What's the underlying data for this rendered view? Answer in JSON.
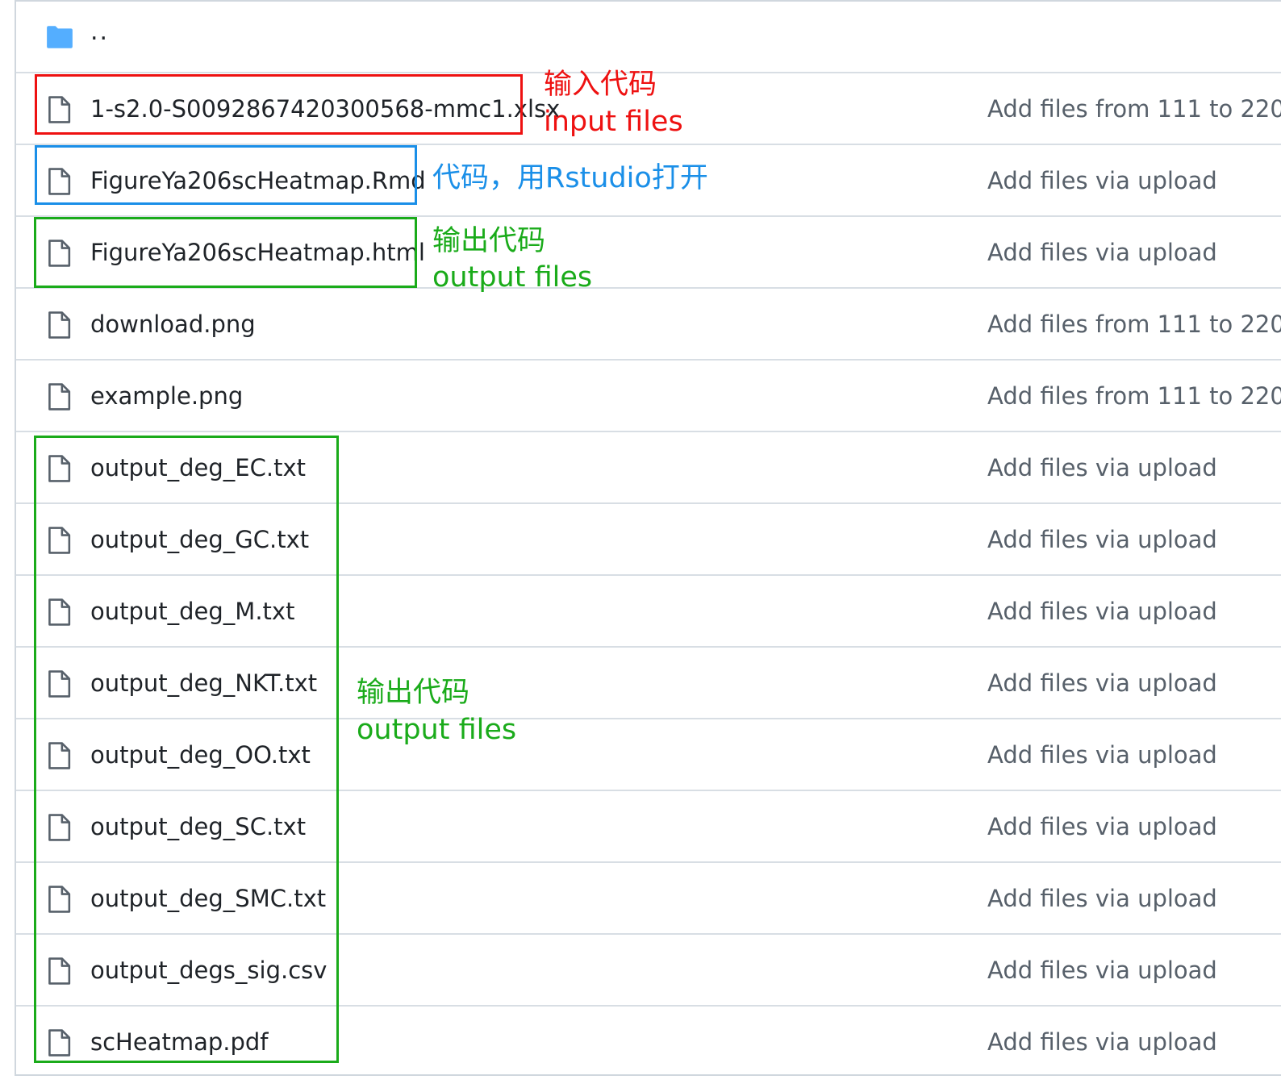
{
  "parent_dir": {
    "label": "..",
    "icon": "folder-icon"
  },
  "files": [
    {
      "name": "1-s2.0-S0092867420300568-mmc1.xlsx",
      "commit_message": "Add files from 111 to 220",
      "icon": "file-icon"
    },
    {
      "name": "FigureYa206scHeatmap.Rmd",
      "commit_message": "Add files via upload",
      "icon": "file-icon"
    },
    {
      "name": "FigureYa206scHeatmap.html",
      "commit_message": "Add files via upload",
      "icon": "file-icon"
    },
    {
      "name": "download.png",
      "commit_message": "Add files from 111 to 220",
      "icon": "file-icon"
    },
    {
      "name": "example.png",
      "commit_message": "Add files from 111 to 220",
      "icon": "file-icon"
    },
    {
      "name": "output_deg_EC.txt",
      "commit_message": "Add files via upload",
      "icon": "file-icon"
    },
    {
      "name": "output_deg_GC.txt",
      "commit_message": "Add files via upload",
      "icon": "file-icon"
    },
    {
      "name": "output_deg_M.txt",
      "commit_message": "Add files via upload",
      "icon": "file-icon"
    },
    {
      "name": "output_deg_NKT.txt",
      "commit_message": "Add files via upload",
      "icon": "file-icon"
    },
    {
      "name": "output_deg_OO.txt",
      "commit_message": "Add files via upload",
      "icon": "file-icon"
    },
    {
      "name": "output_deg_SC.txt",
      "commit_message": "Add files via upload",
      "icon": "file-icon"
    },
    {
      "name": "output_deg_SMC.txt",
      "commit_message": "Add files via upload",
      "icon": "file-icon"
    },
    {
      "name": "output_degs_sig.csv",
      "commit_message": "Add files via upload",
      "icon": "file-icon"
    },
    {
      "name": "scHeatmap.pdf",
      "commit_message": "Add files via upload",
      "icon": "file-icon"
    }
  ],
  "annotations": {
    "input": {
      "zh": "输入代码",
      "en": "input files",
      "color": "#ee1111"
    },
    "code": {
      "zh": "代码，用Rstudio打开",
      "color": "#1a8fe8"
    },
    "output_html": {
      "zh": "输出代码",
      "en": "output files",
      "color": "#1aab1a"
    },
    "output_group": {
      "zh": "输出代码",
      "en": "output files",
      "color": "#1aab1a"
    }
  },
  "colors": {
    "folder": "#54aeff",
    "file_icon": "#57606a",
    "border": "#d0d7de"
  }
}
